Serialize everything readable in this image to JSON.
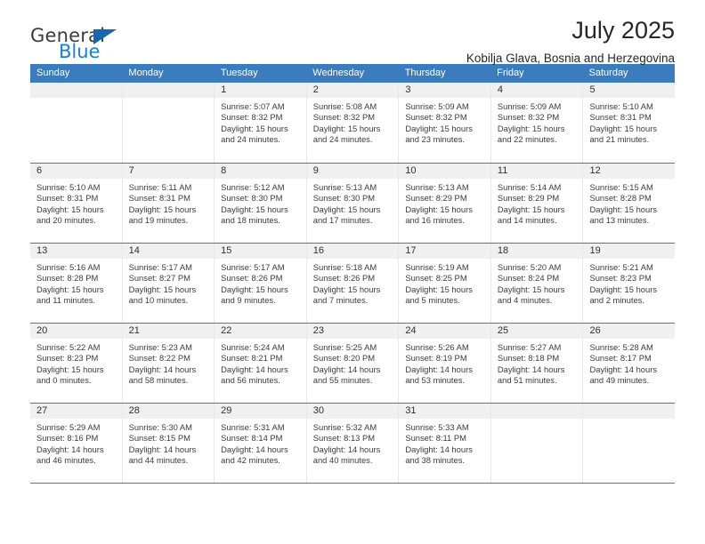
{
  "brand": {
    "name_part1": "General",
    "name_part2": "Blue",
    "triangle_color": "#1567b2",
    "blue_color": "#1b7fd1"
  },
  "header": {
    "title": "July 2025",
    "subtitle": "Kobilja Glava, Bosnia and Herzegovina"
  },
  "theme": {
    "header_bar": "#3a7cbe",
    "daynum_band": "#f0f0f0",
    "grid_line": "#e8e8e8",
    "text": "#3b3b3b"
  },
  "weekdays": [
    "Sunday",
    "Monday",
    "Tuesday",
    "Wednesday",
    "Thursday",
    "Friday",
    "Saturday"
  ],
  "weeks": [
    [
      {
        "day": "",
        "lines": []
      },
      {
        "day": "",
        "lines": []
      },
      {
        "day": "1",
        "lines": [
          "Sunrise: 5:07 AM",
          "Sunset: 8:32 PM",
          "Daylight: 15 hours",
          "and 24 minutes."
        ]
      },
      {
        "day": "2",
        "lines": [
          "Sunrise: 5:08 AM",
          "Sunset: 8:32 PM",
          "Daylight: 15 hours",
          "and 24 minutes."
        ]
      },
      {
        "day": "3",
        "lines": [
          "Sunrise: 5:09 AM",
          "Sunset: 8:32 PM",
          "Daylight: 15 hours",
          "and 23 minutes."
        ]
      },
      {
        "day": "4",
        "lines": [
          "Sunrise: 5:09 AM",
          "Sunset: 8:32 PM",
          "Daylight: 15 hours",
          "and 22 minutes."
        ]
      },
      {
        "day": "5",
        "lines": [
          "Sunrise: 5:10 AM",
          "Sunset: 8:31 PM",
          "Daylight: 15 hours",
          "and 21 minutes."
        ]
      }
    ],
    [
      {
        "day": "6",
        "lines": [
          "Sunrise: 5:10 AM",
          "Sunset: 8:31 PM",
          "Daylight: 15 hours",
          "and 20 minutes."
        ]
      },
      {
        "day": "7",
        "lines": [
          "Sunrise: 5:11 AM",
          "Sunset: 8:31 PM",
          "Daylight: 15 hours",
          "and 19 minutes."
        ]
      },
      {
        "day": "8",
        "lines": [
          "Sunrise: 5:12 AM",
          "Sunset: 8:30 PM",
          "Daylight: 15 hours",
          "and 18 minutes."
        ]
      },
      {
        "day": "9",
        "lines": [
          "Sunrise: 5:13 AM",
          "Sunset: 8:30 PM",
          "Daylight: 15 hours",
          "and 17 minutes."
        ]
      },
      {
        "day": "10",
        "lines": [
          "Sunrise: 5:13 AM",
          "Sunset: 8:29 PM",
          "Daylight: 15 hours",
          "and 16 minutes."
        ]
      },
      {
        "day": "11",
        "lines": [
          "Sunrise: 5:14 AM",
          "Sunset: 8:29 PM",
          "Daylight: 15 hours",
          "and 14 minutes."
        ]
      },
      {
        "day": "12",
        "lines": [
          "Sunrise: 5:15 AM",
          "Sunset: 8:28 PM",
          "Daylight: 15 hours",
          "and 13 minutes."
        ]
      }
    ],
    [
      {
        "day": "13",
        "lines": [
          "Sunrise: 5:16 AM",
          "Sunset: 8:28 PM",
          "Daylight: 15 hours",
          "and 11 minutes."
        ]
      },
      {
        "day": "14",
        "lines": [
          "Sunrise: 5:17 AM",
          "Sunset: 8:27 PM",
          "Daylight: 15 hours",
          "and 10 minutes."
        ]
      },
      {
        "day": "15",
        "lines": [
          "Sunrise: 5:17 AM",
          "Sunset: 8:26 PM",
          "Daylight: 15 hours",
          "and 9 minutes."
        ]
      },
      {
        "day": "16",
        "lines": [
          "Sunrise: 5:18 AM",
          "Sunset: 8:26 PM",
          "Daylight: 15 hours",
          "and 7 minutes."
        ]
      },
      {
        "day": "17",
        "lines": [
          "Sunrise: 5:19 AM",
          "Sunset: 8:25 PM",
          "Daylight: 15 hours",
          "and 5 minutes."
        ]
      },
      {
        "day": "18",
        "lines": [
          "Sunrise: 5:20 AM",
          "Sunset: 8:24 PM",
          "Daylight: 15 hours",
          "and 4 minutes."
        ]
      },
      {
        "day": "19",
        "lines": [
          "Sunrise: 5:21 AM",
          "Sunset: 8:23 PM",
          "Daylight: 15 hours",
          "and 2 minutes."
        ]
      }
    ],
    [
      {
        "day": "20",
        "lines": [
          "Sunrise: 5:22 AM",
          "Sunset: 8:23 PM",
          "Daylight: 15 hours",
          "and 0 minutes."
        ]
      },
      {
        "day": "21",
        "lines": [
          "Sunrise: 5:23 AM",
          "Sunset: 8:22 PM",
          "Daylight: 14 hours",
          "and 58 minutes."
        ]
      },
      {
        "day": "22",
        "lines": [
          "Sunrise: 5:24 AM",
          "Sunset: 8:21 PM",
          "Daylight: 14 hours",
          "and 56 minutes."
        ]
      },
      {
        "day": "23",
        "lines": [
          "Sunrise: 5:25 AM",
          "Sunset: 8:20 PM",
          "Daylight: 14 hours",
          "and 55 minutes."
        ]
      },
      {
        "day": "24",
        "lines": [
          "Sunrise: 5:26 AM",
          "Sunset: 8:19 PM",
          "Daylight: 14 hours",
          "and 53 minutes."
        ]
      },
      {
        "day": "25",
        "lines": [
          "Sunrise: 5:27 AM",
          "Sunset: 8:18 PM",
          "Daylight: 14 hours",
          "and 51 minutes."
        ]
      },
      {
        "day": "26",
        "lines": [
          "Sunrise: 5:28 AM",
          "Sunset: 8:17 PM",
          "Daylight: 14 hours",
          "and 49 minutes."
        ]
      }
    ],
    [
      {
        "day": "27",
        "lines": [
          "Sunrise: 5:29 AM",
          "Sunset: 8:16 PM",
          "Daylight: 14 hours",
          "and 46 minutes."
        ]
      },
      {
        "day": "28",
        "lines": [
          "Sunrise: 5:30 AM",
          "Sunset: 8:15 PM",
          "Daylight: 14 hours",
          "and 44 minutes."
        ]
      },
      {
        "day": "29",
        "lines": [
          "Sunrise: 5:31 AM",
          "Sunset: 8:14 PM",
          "Daylight: 14 hours",
          "and 42 minutes."
        ]
      },
      {
        "day": "30",
        "lines": [
          "Sunrise: 5:32 AM",
          "Sunset: 8:13 PM",
          "Daylight: 14 hours",
          "and 40 minutes."
        ]
      },
      {
        "day": "31",
        "lines": [
          "Sunrise: 5:33 AM",
          "Sunset: 8:11 PM",
          "Daylight: 14 hours",
          "and 38 minutes."
        ]
      },
      {
        "day": "",
        "lines": []
      },
      {
        "day": "",
        "lines": []
      }
    ]
  ]
}
